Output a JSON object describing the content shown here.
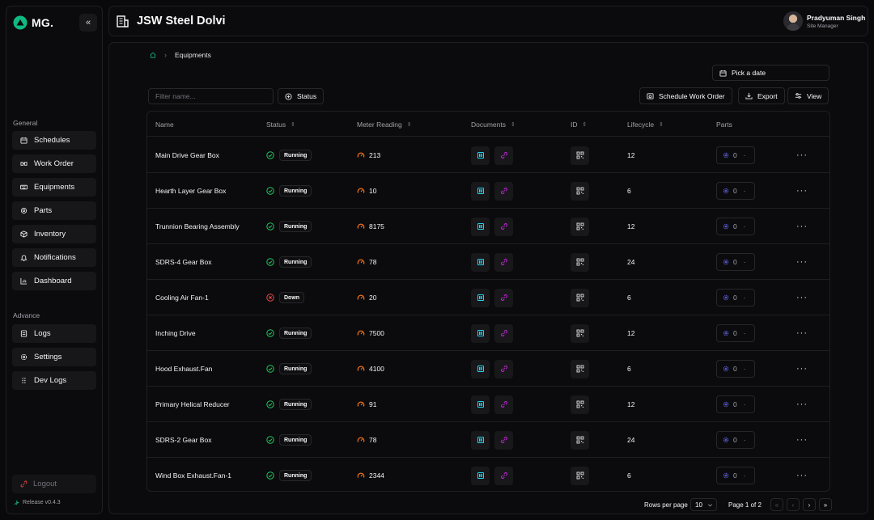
{
  "brand": {
    "name": "MG.",
    "collapse_icon": "double-chevron-left-icon",
    "collapse_glyph": "«"
  },
  "sidebar": {
    "sections": [
      {
        "title": "General",
        "items": [
          {
            "label": "Schedules",
            "icon": "calendar-icon"
          },
          {
            "label": "Work Order",
            "icon": "tools-icon"
          },
          {
            "label": "Equipments",
            "icon": "keyboard-icon"
          },
          {
            "label": "Parts",
            "icon": "gear-icon"
          },
          {
            "label": "Inventory",
            "icon": "box-icon"
          },
          {
            "label": "Notifications",
            "icon": "bell-icon"
          },
          {
            "label": "Dashboard",
            "icon": "chart-icon"
          }
        ]
      },
      {
        "title": "Advance",
        "items": [
          {
            "label": "Logs",
            "icon": "file-text-icon"
          },
          {
            "label": "Settings",
            "icon": "gear-icon"
          },
          {
            "label": "Dev Logs",
            "icon": "grip-icon"
          }
        ]
      }
    ],
    "logout_label": "Logout",
    "release_label": "Release v0.4.3"
  },
  "header": {
    "site_title": "JSW Steel Dolvi",
    "user_name": "Pradyuman Singh",
    "user_role": "Site Manager"
  },
  "breadcrumb": {
    "page": "Equipments"
  },
  "toolbar": {
    "date_label": "Pick a date",
    "filter_placeholder": "Filter name...",
    "status_label": "Status",
    "schedule_label": "Schedule Work Order",
    "export_label": "Export",
    "view_label": "View"
  },
  "table": {
    "columns": [
      "Name",
      "Status",
      "Meter Reading",
      "Documents",
      "ID",
      "Lifecycle",
      "Parts"
    ],
    "sort_glyph": "⇕",
    "rows": [
      {
        "name": "Main Drive Gear Box",
        "status": "Running",
        "meter": "213",
        "lifecycle": "12",
        "parts": "0"
      },
      {
        "name": "Hearth Layer Gear Box",
        "status": "Running",
        "meter": "10",
        "lifecycle": "6",
        "parts": "0"
      },
      {
        "name": "Trunnion Bearing Assembly",
        "status": "Running",
        "meter": "8175",
        "lifecycle": "12",
        "parts": "0"
      },
      {
        "name": "SDRS-4 Gear Box",
        "status": "Running",
        "meter": "78",
        "lifecycle": "24",
        "parts": "0"
      },
      {
        "name": "Cooling Air Fan-1",
        "status": "Down",
        "meter": "20",
        "lifecycle": "6",
        "parts": "0"
      },
      {
        "name": "Inching Drive",
        "status": "Running",
        "meter": "7500",
        "lifecycle": "12",
        "parts": "0"
      },
      {
        "name": "Hood Exhaust.Fan",
        "status": "Running",
        "meter": "4100",
        "lifecycle": "6",
        "parts": "0"
      },
      {
        "name": "Primary Helical Reducer",
        "status": "Running",
        "meter": "91",
        "lifecycle": "12",
        "parts": "0"
      },
      {
        "name": "SDRS-2 Gear Box",
        "status": "Running",
        "meter": "78",
        "lifecycle": "24",
        "parts": "0"
      },
      {
        "name": "Wind Box Exhaust.Fan-1",
        "status": "Running",
        "meter": "2344",
        "lifecycle": "6",
        "parts": "0"
      }
    ]
  },
  "pagination": {
    "rows_per_page_label": "Rows per page",
    "rows_per_page": "10",
    "page_label": "Page 1 of 2",
    "first_glyph": "«",
    "prev_glyph": "‹",
    "next_glyph": "›",
    "last_glyph": "»"
  },
  "colors": {
    "background": "#09090b",
    "running": "#22c55e",
    "down": "#ef4444",
    "meter": "#f97316",
    "document": "#22d3ee",
    "link": "#c026d3",
    "parts": "#6366f1"
  }
}
